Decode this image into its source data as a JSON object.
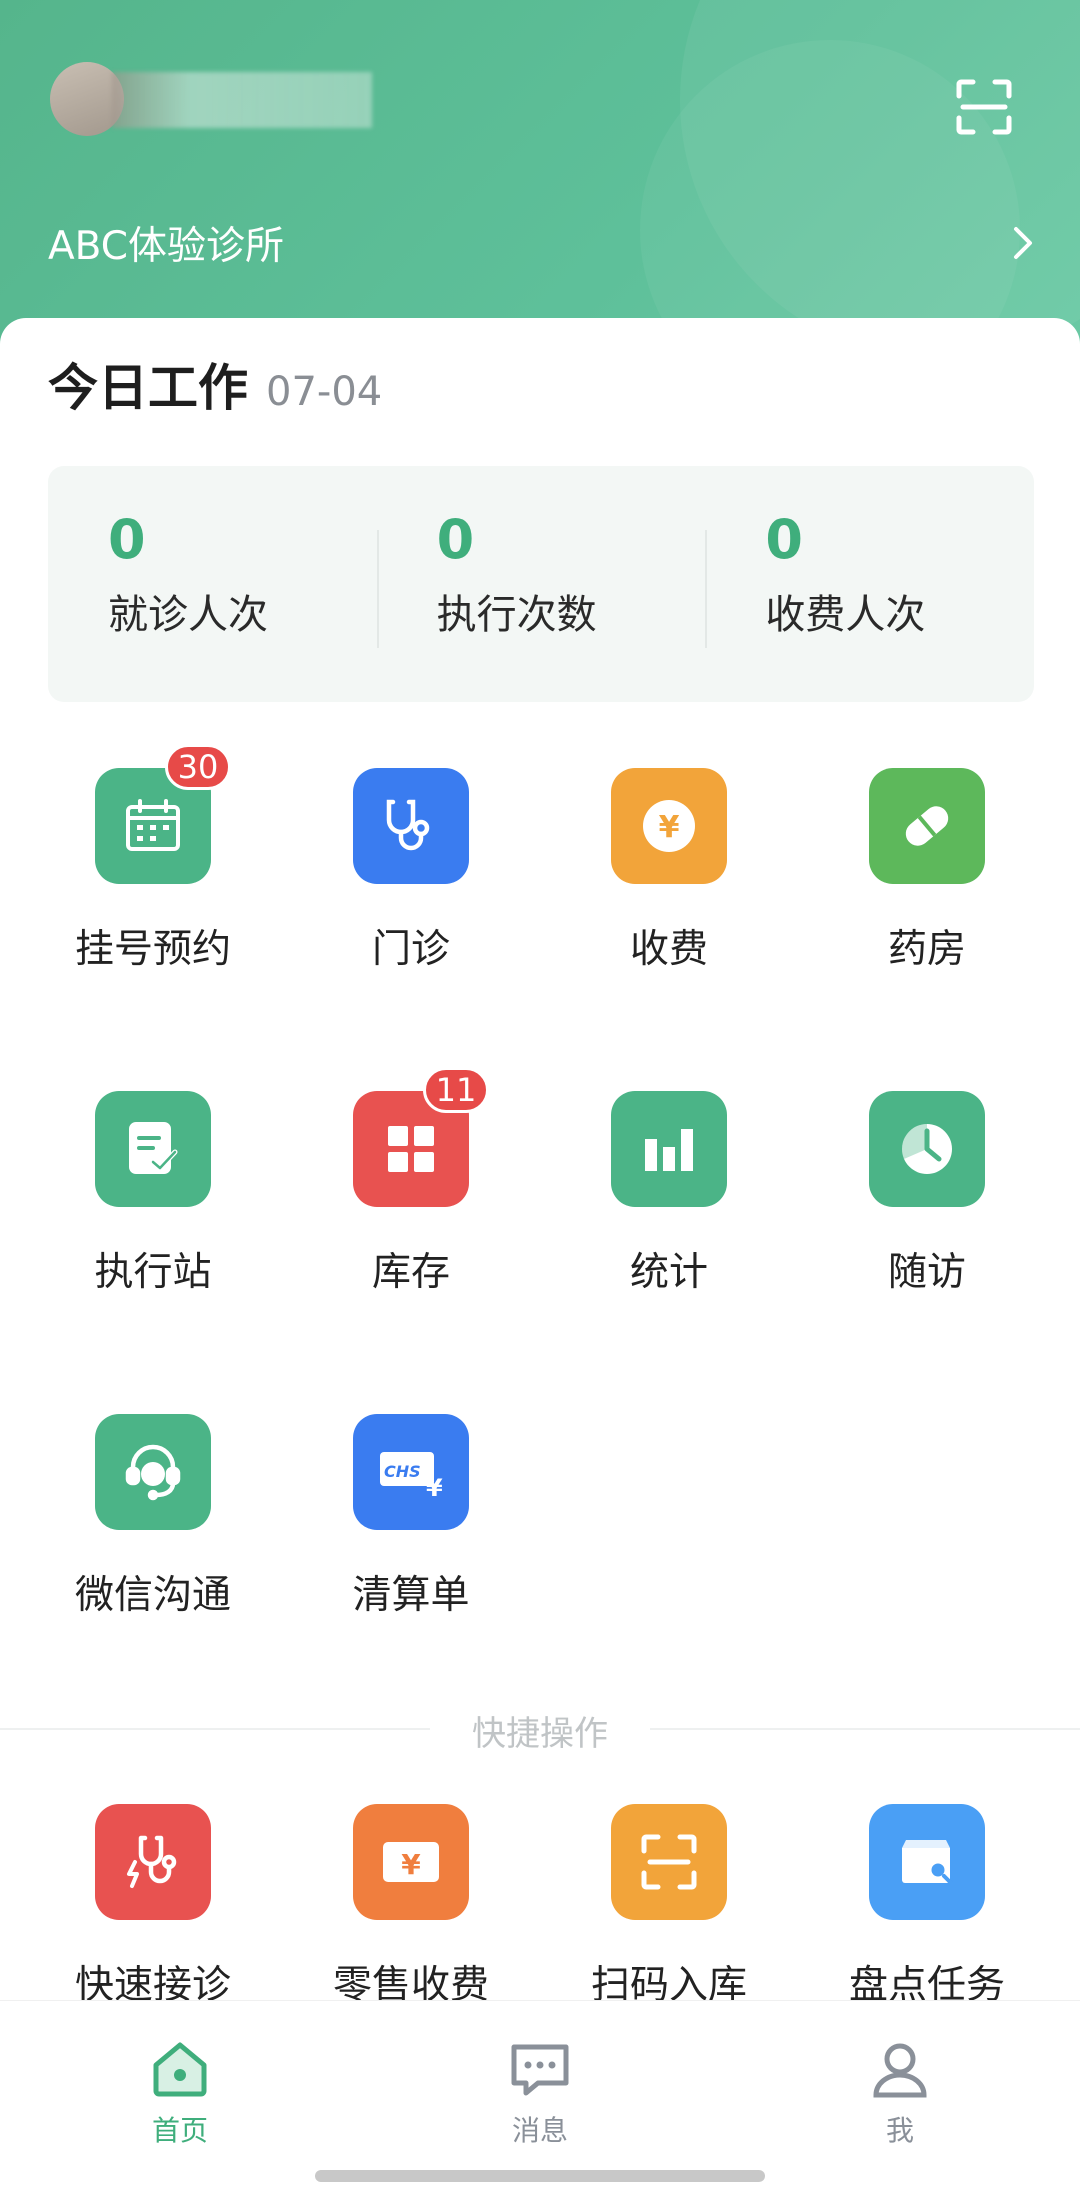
{
  "header": {
    "clinic_name": "ABC体验诊所"
  },
  "today": {
    "title": "今日工作",
    "date": "07-04",
    "stats": [
      {
        "value": "0",
        "label": "就诊人次"
      },
      {
        "value": "0",
        "label": "执行次数"
      },
      {
        "value": "0",
        "label": "收费人次"
      }
    ]
  },
  "apps": [
    {
      "label": "挂号预约",
      "badge": "30",
      "icon": "calendar-icon",
      "color": "#4bb487"
    },
    {
      "label": "门诊",
      "badge": "",
      "icon": "stethoscope-icon",
      "color": "#3a7cf0"
    },
    {
      "label": "收费",
      "badge": "",
      "icon": "yen-coin-icon",
      "color": "#f2a43a"
    },
    {
      "label": "药房",
      "badge": "",
      "icon": "pill-icon",
      "color": "#5db85b"
    },
    {
      "label": "执行站",
      "badge": "",
      "icon": "checklist-icon",
      "color": "#4bb487"
    },
    {
      "label": "库存",
      "badge": "11",
      "icon": "grid-icon",
      "color": "#e85250"
    },
    {
      "label": "统计",
      "badge": "",
      "icon": "bar-chart-icon",
      "color": "#4bb487"
    },
    {
      "label": "随访",
      "badge": "",
      "icon": "clock-pie-icon",
      "color": "#4bb487"
    },
    {
      "label": "微信沟通",
      "badge": "",
      "icon": "headset-icon",
      "color": "#4bb487"
    },
    {
      "label": "清算单",
      "badge": "",
      "icon": "chs-card-icon",
      "color": "#3a7cf0"
    }
  ],
  "quick_actions": {
    "title": "快捷操作",
    "items": [
      {
        "label": "快速接诊",
        "icon": "quick-stethoscope-icon",
        "color": "#e85250"
      },
      {
        "label": "零售收费",
        "icon": "yen-ticket-icon",
        "color": "#f07e3e"
      },
      {
        "label": "扫码入库",
        "icon": "scan-icon",
        "color": "#f2a43a"
      },
      {
        "label": "盘点任务",
        "icon": "inventory-search-icon",
        "color": "#4a9ff5"
      }
    ]
  },
  "nav": {
    "items": [
      {
        "label": "首页",
        "active": true
      },
      {
        "label": "消息",
        "active": false
      },
      {
        "label": "我",
        "active": false
      }
    ],
    "active_color": "#3fae7c",
    "inactive_color": "#8a9099"
  }
}
